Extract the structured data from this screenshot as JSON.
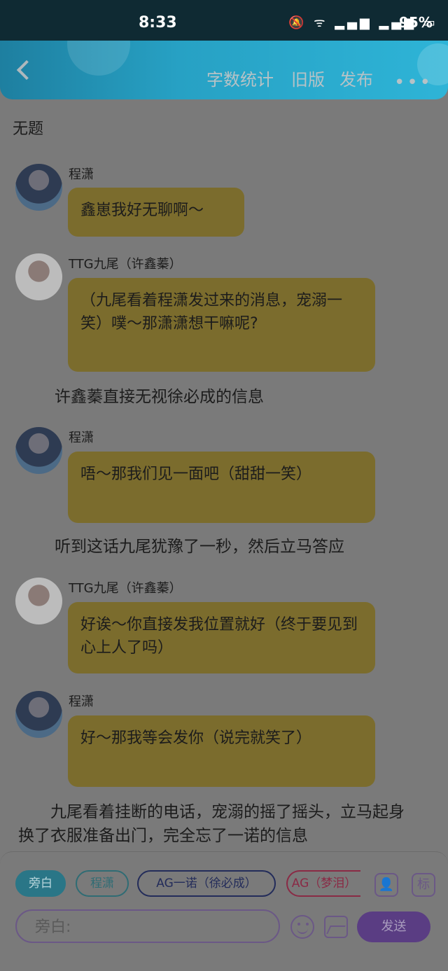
{
  "status_bar": {
    "time": "8:33",
    "icons": "🔕 ᯤ ▂▄▆ ▂▄▆ ▭",
    "battery": "95%"
  },
  "header": {
    "word_count": "字数统计",
    "old_version": "旧版",
    "publish": "发布",
    "more": "•••"
  },
  "page_title": "无题",
  "messages": [
    {
      "speaker": "程潇",
      "text": "鑫崽我好无聊啊～"
    },
    {
      "speaker": "TTG九尾（许鑫蓁）",
      "text": "（九尾看着程潇发过来的消息，宠溺一笑）噗～那潇潇想干嘛呢?"
    },
    {
      "narration": "许鑫蓁直接无视徐必成的信息"
    },
    {
      "speaker": "程潇",
      "text": "唔～那我们见一面吧（甜甜一笑）"
    },
    {
      "narration": "听到这话九尾犹豫了一秒，然后立马答应"
    },
    {
      "speaker": "TTG九尾（许鑫蓁）",
      "text": "好诶～你直接发我位置就好（终于要见到心上人了吗）"
    },
    {
      "speaker": "程潇",
      "text": "好～那我等会发你（说完就笑了）"
    },
    {
      "narration": "　　九尾看着挂断的电话，宠溺的摇了摇头，立马起身换了衣服准备出门，完全忘了一诺的信息"
    }
  ],
  "roles": [
    "旁白",
    "程潇",
    "AG一诺（徐必成）",
    "AG（梦泪）"
  ],
  "role_buttons": {
    "profile": "👤",
    "mark": "标"
  },
  "composer": {
    "placeholder": "旁白:",
    "send_label": "发送"
  },
  "colors": {
    "header": "#27a1c4",
    "bubble": "#7b6c2d",
    "accent": "#5a3d83"
  }
}
